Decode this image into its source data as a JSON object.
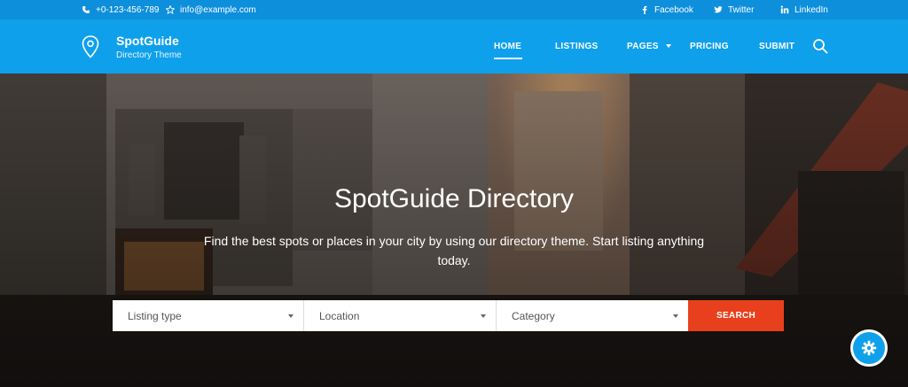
{
  "topbar": {
    "phone": "+0-123-456-789",
    "email": "info@example.com",
    "social": [
      {
        "label": "Facebook",
        "icon": "facebook-icon"
      },
      {
        "label": "Twitter",
        "icon": "twitter-icon"
      },
      {
        "label": "LinkedIn",
        "icon": "linkedin-icon"
      }
    ]
  },
  "header": {
    "brand": "SpotGuide",
    "tagline": "Directory Theme",
    "nav": [
      {
        "label": "HOME",
        "active": true
      },
      {
        "label": "LISTINGS"
      },
      {
        "label": "PAGES",
        "has_dropdown": true
      },
      {
        "label": "PRICING"
      },
      {
        "label": "SUBMIT"
      }
    ]
  },
  "hero": {
    "title": "SpotGuide Directory",
    "subtitle": "Find the best spots or places in your city by using our directory theme. Start listing anything today."
  },
  "search": {
    "listing_type": "Listing type",
    "location": "Location",
    "category": "Category",
    "button": "SEARCH"
  },
  "colors": {
    "primary": "#0fa0ec",
    "topbar": "#0d8fdc",
    "accent": "#e8401c"
  }
}
